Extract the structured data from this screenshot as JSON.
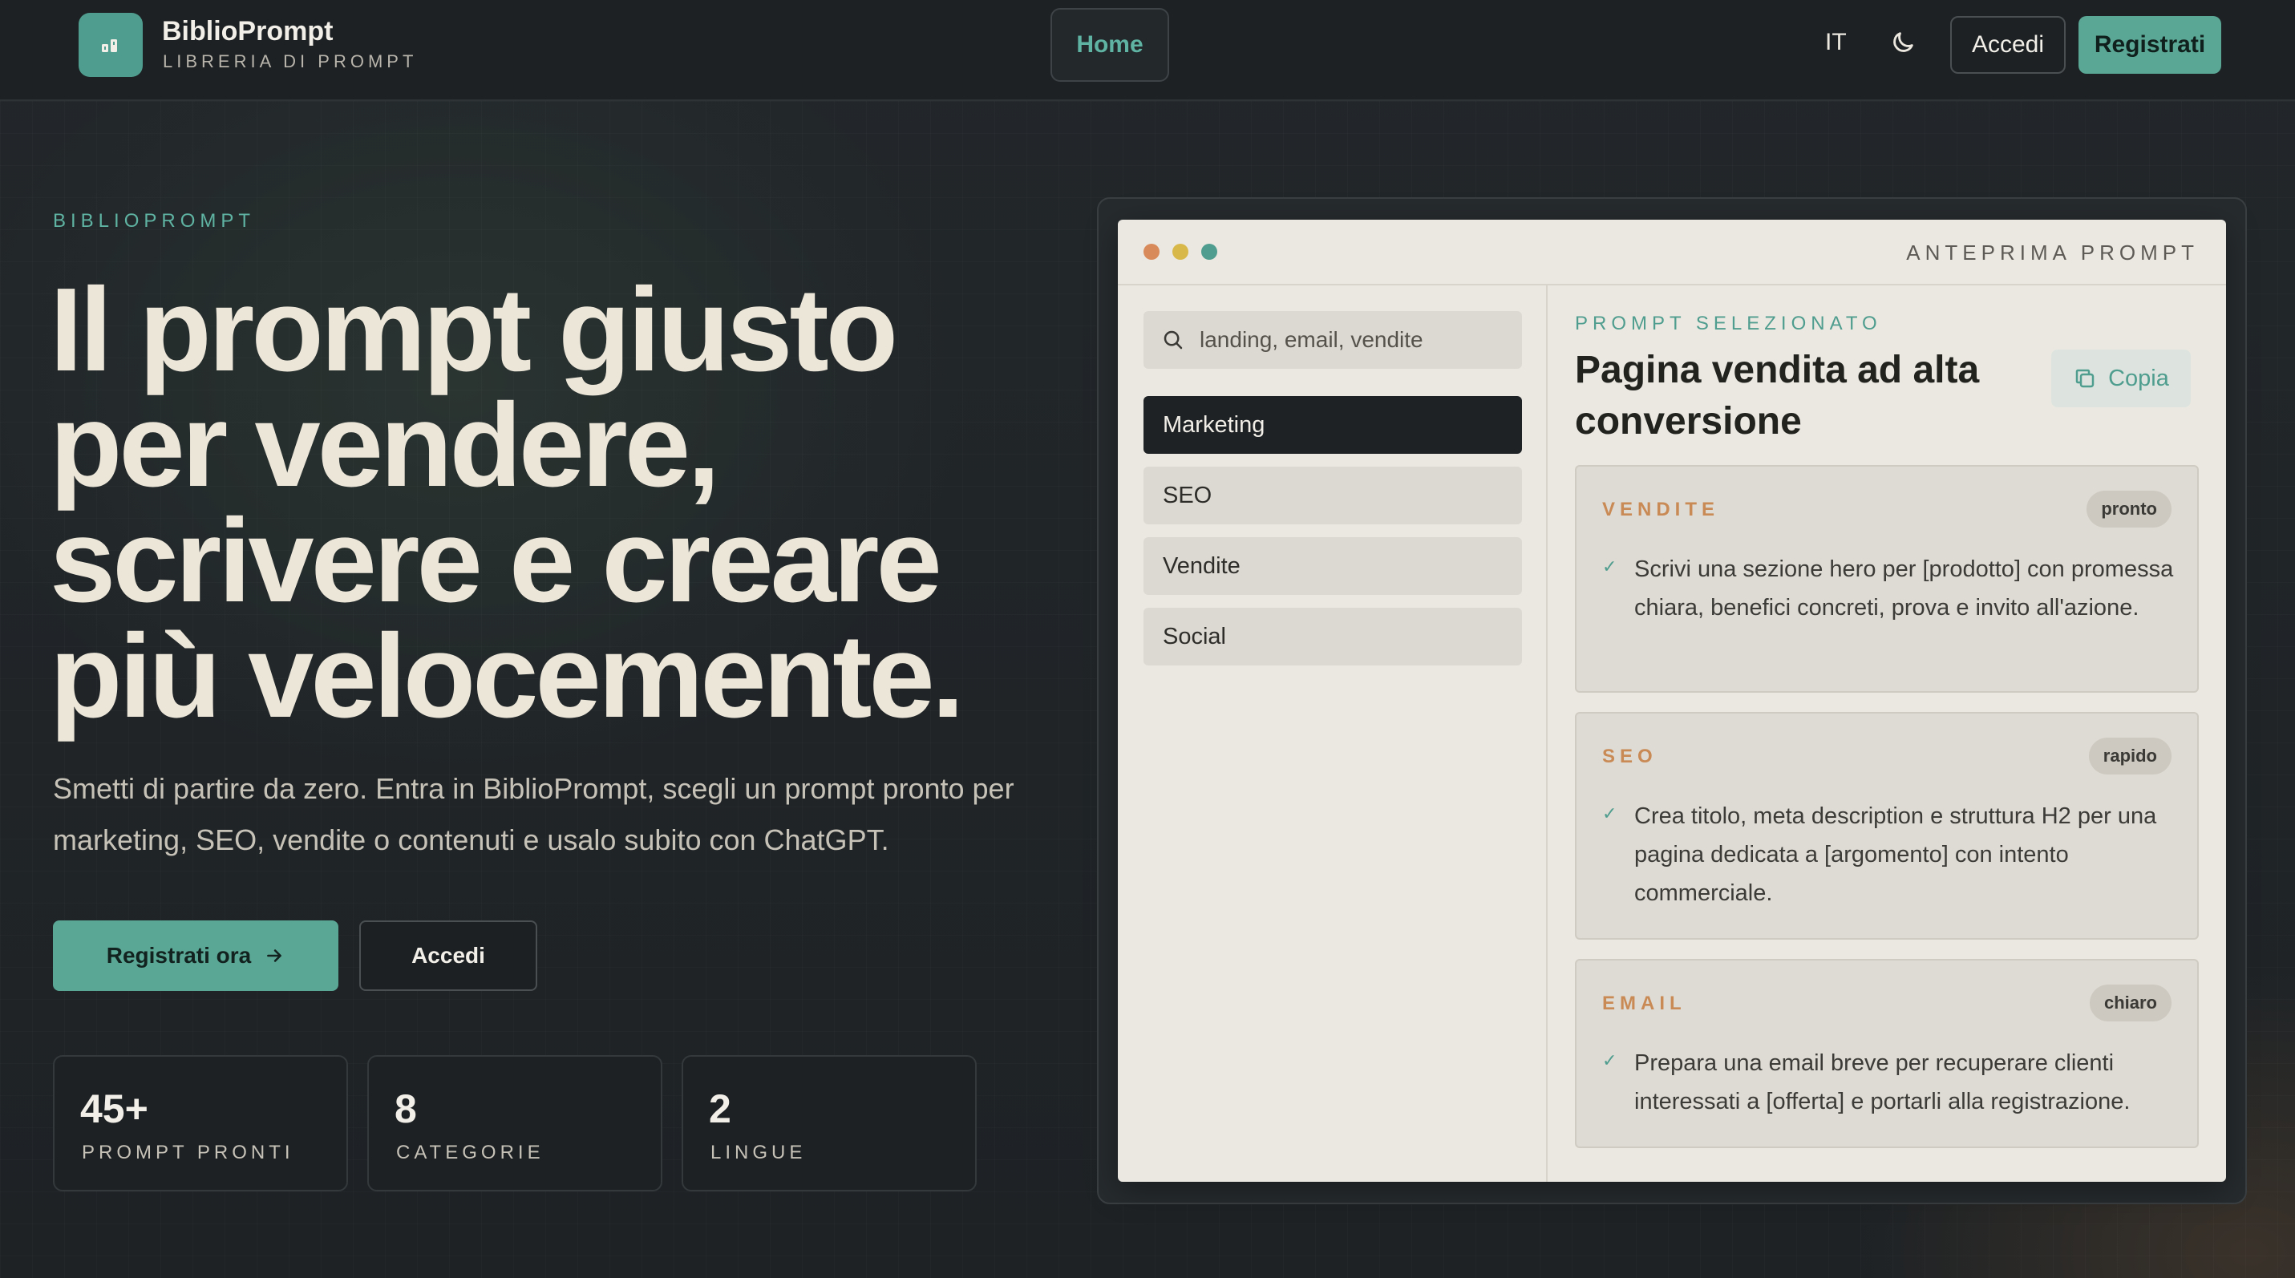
{
  "nav": {
    "brand_name": "BiblioPrompt",
    "brand_sub": "LIBRERIA DI PROMPT",
    "home": "Home",
    "lang": "IT",
    "login": "Accedi",
    "register": "Registrati"
  },
  "hero": {
    "eyebrow": "BIBLIOPROMPT",
    "title_lines": [
      "Il prompt giusto",
      "per vendere,",
      "scrivere e creare",
      "più velocemente."
    ],
    "subtitle": "Smetti di partire da zero. Entra in BiblioPrompt, scegli un prompt pronto per marketing, SEO, vendite o contenuti e usalo subito con ChatGPT.",
    "cta_primary": "Registrati ora",
    "cta_secondary": "Accedi",
    "stats": [
      {
        "value": "45+",
        "label": "PROMPT PRONTI"
      },
      {
        "value": "8",
        "label": "CATEGORIE"
      },
      {
        "value": "2",
        "label": "LINGUE"
      }
    ]
  },
  "preview": {
    "window_title": "ANTEPRIMA PROMPT",
    "search_placeholder": "landing, email, vendite",
    "categories": [
      "Marketing",
      "SEO",
      "Vendite",
      "Social"
    ],
    "active_category": "Marketing",
    "selected_eyebrow": "PROMPT SELEZIONATO",
    "selected_title": "Pagina vendita ad alta conversione",
    "copy_label": "Copia",
    "cards": [
      {
        "name": "VENDITE",
        "badge": "pronto",
        "text": "Scrivi una sezione hero per [prodotto] con promessa chiara, benefici concreti, prova e invito all'azione."
      },
      {
        "name": "SEO",
        "badge": "rapido",
        "text": "Crea titolo, meta description e struttura H2 per una pagina dedicata a [argomento] con intento commerciale."
      },
      {
        "name": "EMAIL",
        "badge": "chiaro",
        "text": "Prepara una email breve per recuperare clienti interessati a [offerta] e portarli alla registrazione."
      }
    ]
  },
  "colors": {
    "accent": "#5aa796",
    "background": "#1f2326",
    "card_label": "#c98a55",
    "dot_red": "#d98a5a",
    "dot_yellow": "#d9b84a",
    "dot_green": "#4f9d8e"
  },
  "icons": {
    "logo": "library-icon",
    "theme": "moon-icon",
    "arrow": "arrow-right-icon",
    "search": "search-icon",
    "copy": "copy-icon",
    "check": "check-icon"
  }
}
